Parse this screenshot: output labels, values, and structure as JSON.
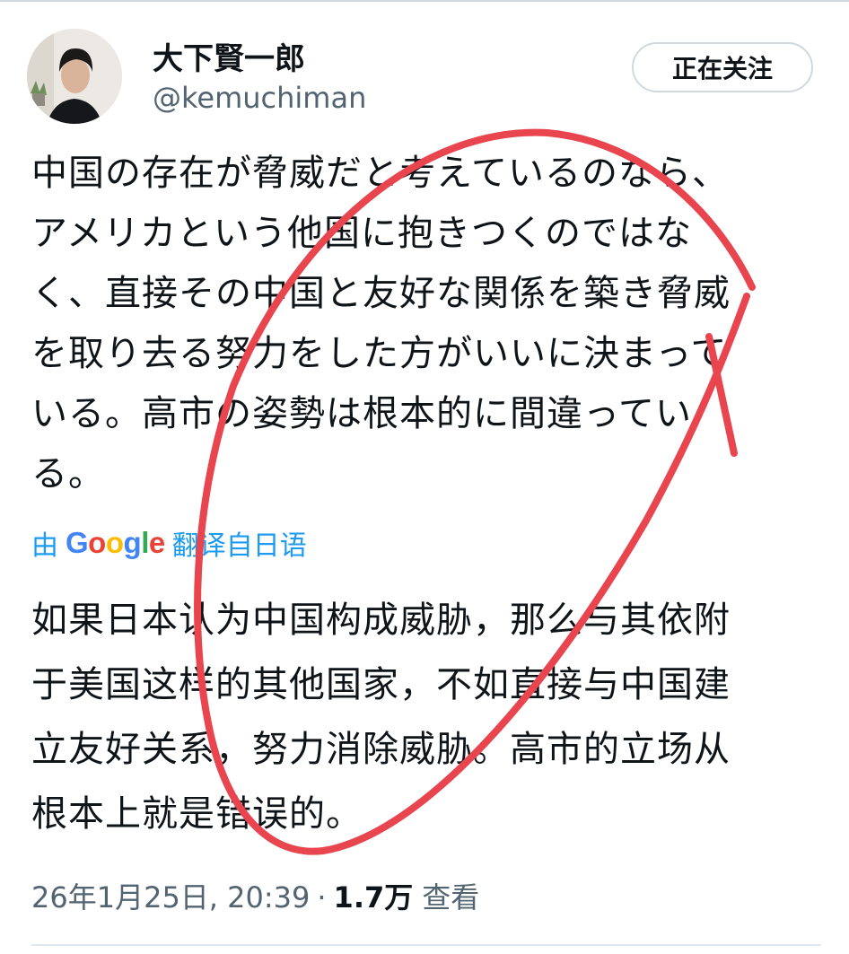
{
  "author": {
    "name": "大下賢一郎",
    "handle": "@kemuchiman"
  },
  "follow_button": {
    "label": "正在关注"
  },
  "tweet": {
    "lines": [
      "中国の存在が脅威だと考えているのなら、",
      "アメリカという他国に抱きつくのではな",
      "く、直接その中国と友好な関係を築き脅威",
      "を取り去る努力をした方がいいに決まって",
      "いる。高市の姿勢は根本的に間違ってい",
      "る。"
    ]
  },
  "translation": {
    "prefix": "由",
    "google_letters": [
      {
        "ch": "G",
        "color": "#4285F4"
      },
      {
        "ch": "o",
        "color": "#EA4335"
      },
      {
        "ch": "o",
        "color": "#FBBC05"
      },
      {
        "ch": "g",
        "color": "#4285F4"
      },
      {
        "ch": "l",
        "color": "#34A853"
      },
      {
        "ch": "e",
        "color": "#EA4335"
      }
    ],
    "suffix": "翻译自日语",
    "lines": [
      "如果日本认为中国构成威胁，那么与其依附",
      "于美国这样的其他国家，不如直接与中国建",
      "立友好关系，努力消除威胁。高市的立场从",
      "根本上就是错误的。"
    ]
  },
  "meta": {
    "timestamp": "26年1月25日, 20:39",
    "separator": "·",
    "views_count": "1.7万",
    "views_label": "查看"
  },
  "colors": {
    "accent": "#1d9bf0",
    "secondary_text": "#536471",
    "annotation": "#e8454f"
  }
}
